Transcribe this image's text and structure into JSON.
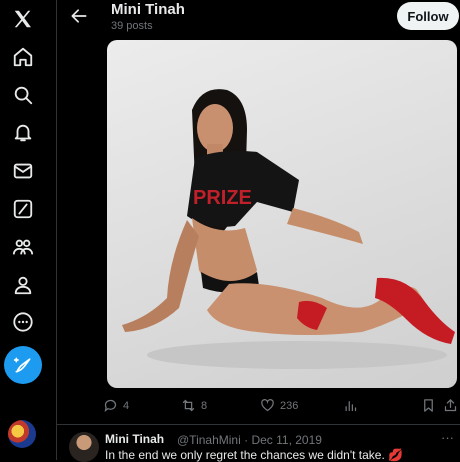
{
  "nav": {
    "items": [
      {
        "icon": "x-logo-icon"
      },
      {
        "icon": "home-icon"
      },
      {
        "icon": "search-icon"
      },
      {
        "icon": "notifications-icon"
      },
      {
        "icon": "messages-icon"
      },
      {
        "icon": "grok-icon"
      },
      {
        "icon": "communities-icon"
      },
      {
        "icon": "profile-icon"
      },
      {
        "icon": "more-icon"
      }
    ],
    "compose_icon": "compose-post-icon",
    "accent": "#1d9bf0"
  },
  "header": {
    "name": "Mini Tinah",
    "post_count": "39 posts",
    "follow_label": "Follow"
  },
  "post": {
    "shirt_text": "PRIZE",
    "actions": {
      "replies": "4",
      "reposts": "8",
      "likes": "236"
    }
  },
  "next_tweet": {
    "name": "Mini Tinah",
    "handle": "@TinahMini",
    "date": "· Dec 11, 2019",
    "more": "···",
    "text": "In the end we only regret the chances we didn't take. 💋"
  }
}
